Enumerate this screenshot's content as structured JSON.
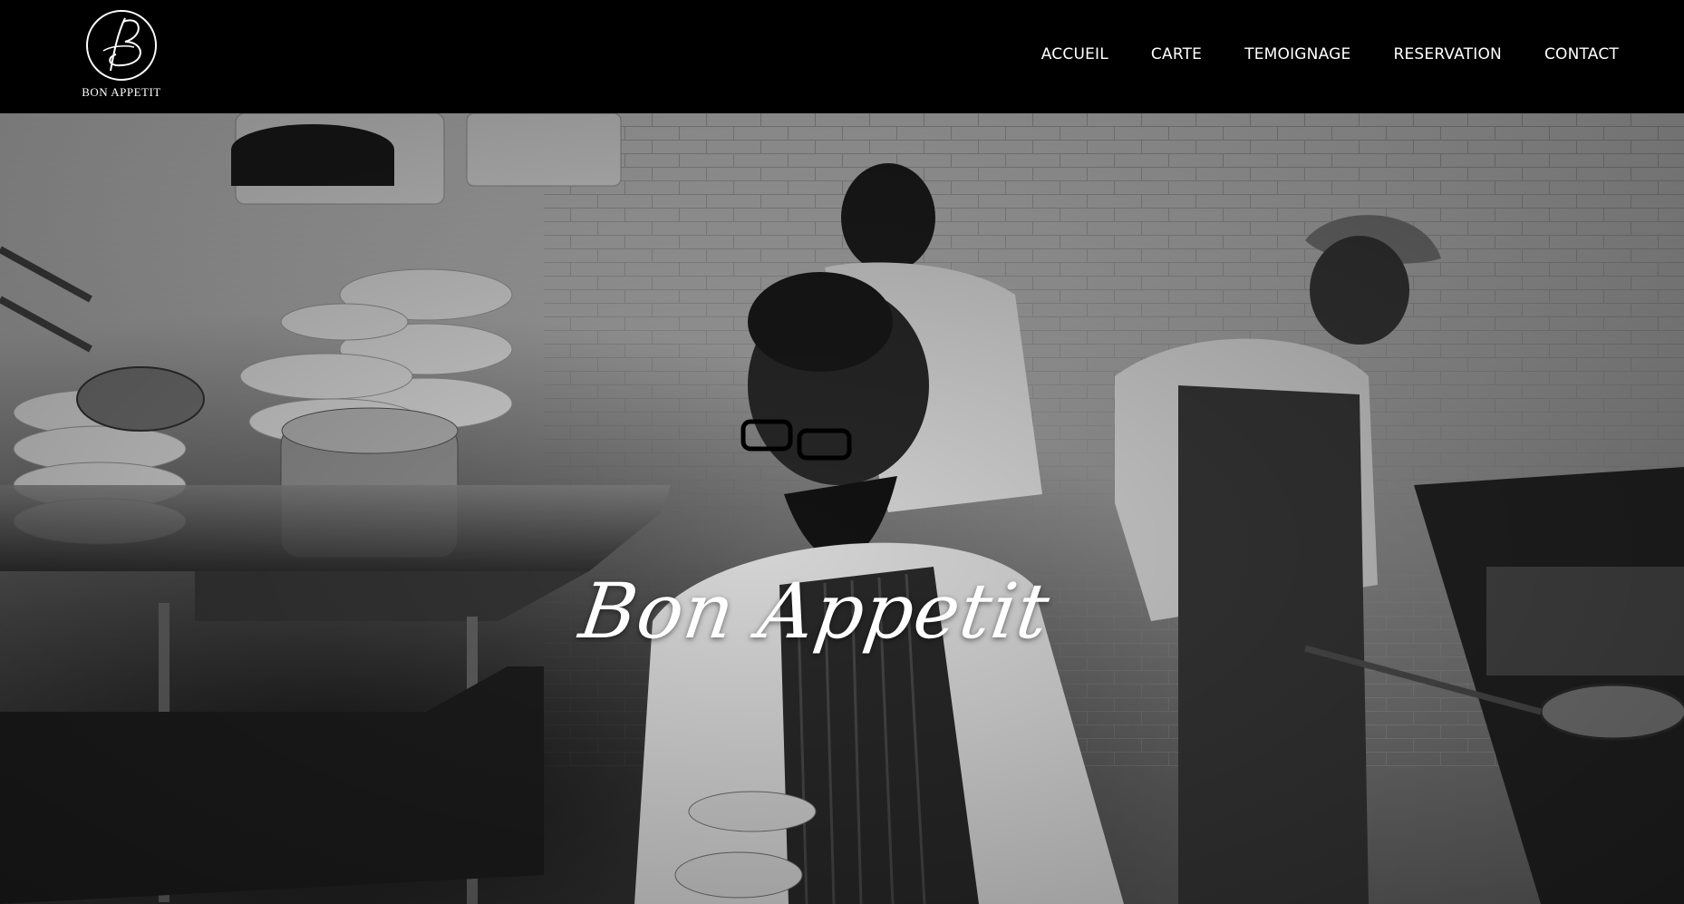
{
  "brand": {
    "logo_monogram": "B",
    "logo_text": "BON APPETIT"
  },
  "nav": {
    "items": [
      {
        "label": "ACCUEIL"
      },
      {
        "label": "CARTE"
      },
      {
        "label": "TEMOIGNAGE"
      },
      {
        "label": "RESERVATION"
      },
      {
        "label": "CONTACT"
      }
    ]
  },
  "hero": {
    "title": "Bon Appetit",
    "image_subject": "kitchen-chefs-photo"
  },
  "colors": {
    "header_bg": "#000000",
    "nav_text": "#ffffff",
    "hero_title": "#ffffff"
  }
}
